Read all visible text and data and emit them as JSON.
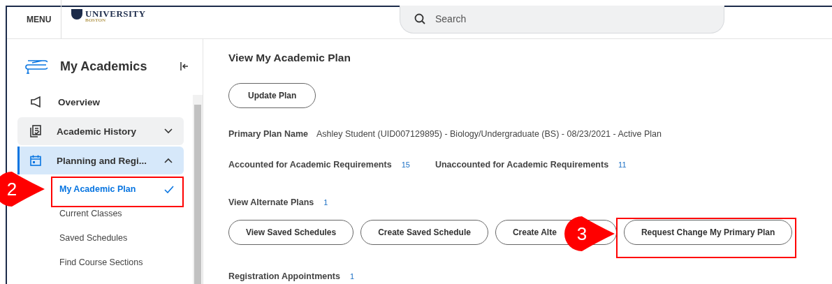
{
  "header": {
    "menu_label": "MENU",
    "logo": {
      "name": "UNIVERSITY",
      "city": "BOSTON"
    },
    "search": {
      "placeholder": "Search"
    }
  },
  "sidebar": {
    "title": "My Academics",
    "items": [
      {
        "kind": "link",
        "label": "Overview",
        "selected": false
      },
      {
        "kind": "group",
        "label": "Academic History",
        "expanded": false,
        "selected": false
      },
      {
        "kind": "group",
        "label": "Planning and Regi...",
        "expanded": true,
        "selected": true,
        "children": [
          {
            "label": "My Academic Plan",
            "selected": true
          },
          {
            "label": "Current Classes",
            "selected": false
          },
          {
            "label": "Saved Schedules",
            "selected": false
          },
          {
            "label": "Find Course Sections",
            "selected": false
          }
        ]
      }
    ]
  },
  "main": {
    "title": "View My Academic Plan",
    "top_button": "Update Plan",
    "primary_plan": {
      "label": "Primary Plan Name",
      "value": "Ashley Student (UID007129895) - Biology/Undergraduate (BS) - 08/23/2021 - Active Plan"
    },
    "counts": [
      {
        "label": "Accounted for Academic Requirements",
        "count": "15"
      },
      {
        "label": "Unaccounted for Academic Requirements",
        "count": "11"
      }
    ],
    "alternate": {
      "label": "View Alternate Plans",
      "count": "1"
    },
    "buttons": [
      "View Saved Schedules",
      "Create Saved Schedule",
      "Create Alte",
      "Request Change My Primary Plan"
    ],
    "appointments": {
      "label": "Registration Appointments",
      "count": "1"
    }
  },
  "annotations": [
    {
      "label": "2"
    },
    {
      "label": "3"
    }
  ]
}
